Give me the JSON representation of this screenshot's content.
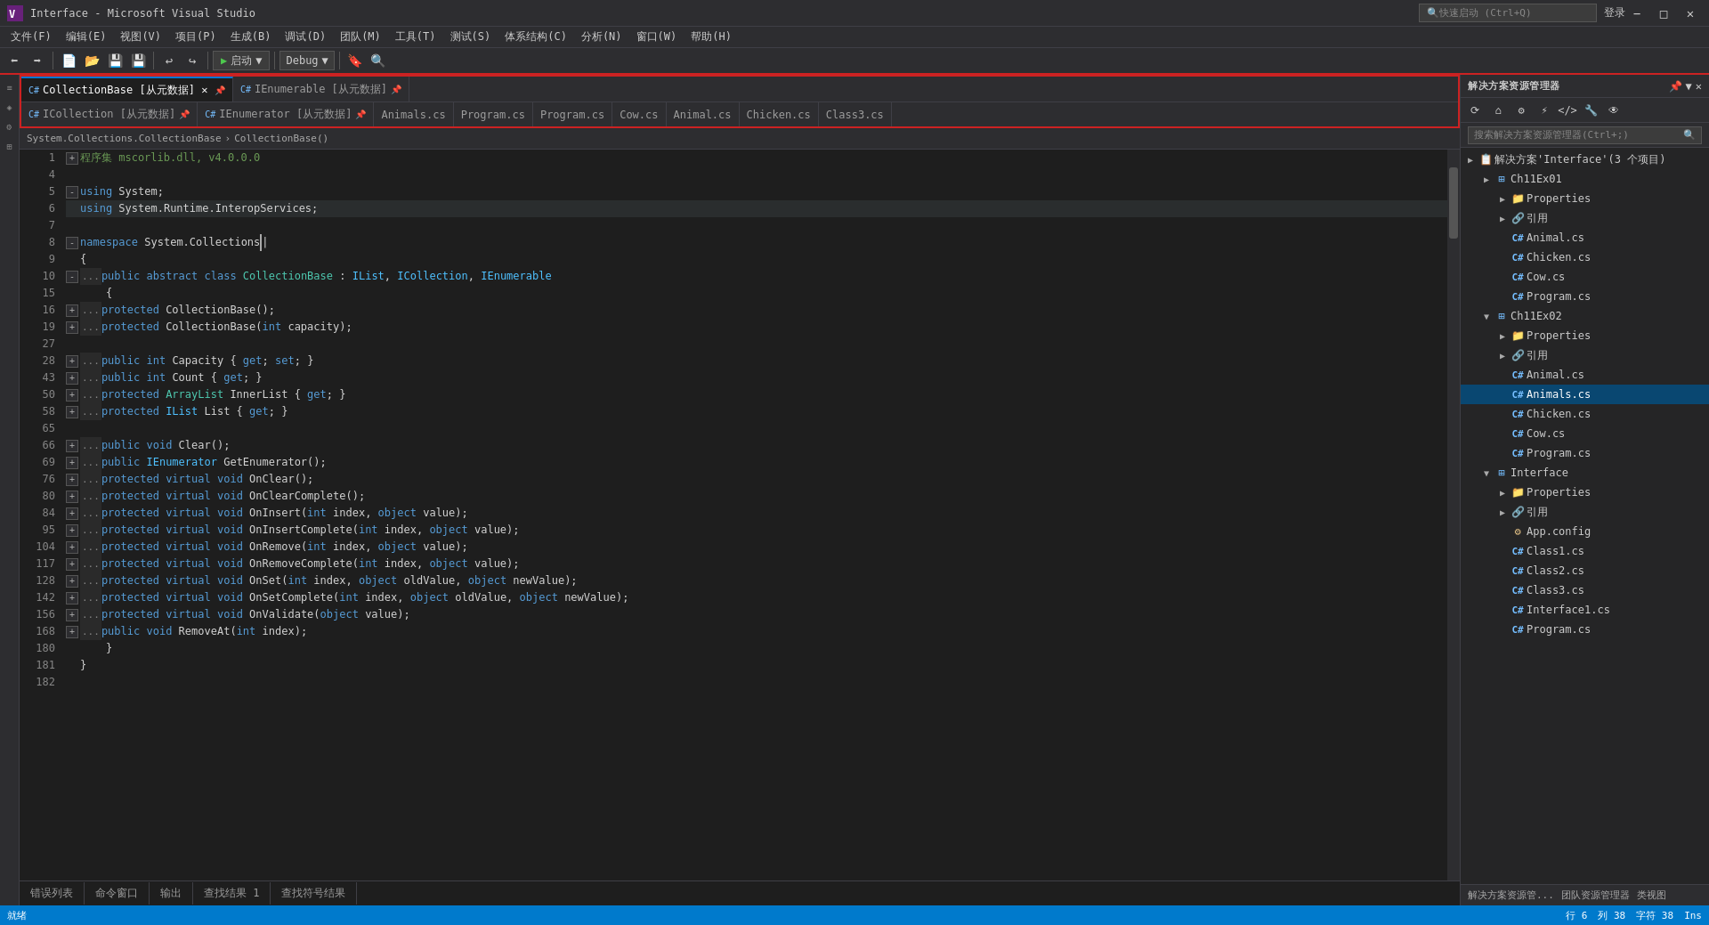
{
  "titleBar": {
    "title": "Interface - Microsoft Visual Studio",
    "quickLaunch": "快速启动 (Ctrl+Q)"
  },
  "menuBar": {
    "items": [
      "文件(F)",
      "编辑(E)",
      "视图(V)",
      "项目(P)",
      "生成(B)",
      "调试(D)",
      "团队(M)",
      "工具(T)",
      "测试(S)",
      "体系结构(C)",
      "分析(N)",
      "窗口(W)",
      "帮助(H)"
    ]
  },
  "toolbar": {
    "debugConfig": "Debug",
    "startBtn": "启动",
    "loginBtn": "登录"
  },
  "tabBarTop": {
    "tabs": [
      {
        "label": "CollectionBase [从元数据]",
        "active": true,
        "hasClose": true,
        "icon": "C#"
      },
      {
        "label": "IEnumerable [从元数据]",
        "active": false,
        "hasClose": false,
        "icon": "C#"
      }
    ]
  },
  "tabBarBottom": {
    "tabs": [
      {
        "label": "ICollection [从元数据]",
        "active": false,
        "icon": "C#"
      },
      {
        "label": "IEnumerator [从元数据]",
        "active": false,
        "icon": "C#"
      },
      {
        "label": "Animals.cs",
        "active": false,
        "icon": "C#"
      },
      {
        "label": "Program.cs",
        "active": false,
        "icon": "C#"
      },
      {
        "label": "Program.cs",
        "active": false,
        "icon": "C#"
      },
      {
        "label": "Cow.cs",
        "active": false,
        "icon": "C#"
      },
      {
        "label": "Animal.cs",
        "active": false,
        "icon": "C#"
      },
      {
        "label": "Chicken.cs",
        "active": false,
        "icon": "C#"
      },
      {
        "label": "Class3.cs",
        "active": false,
        "icon": "C#"
      }
    ]
  },
  "codeNav": {
    "namespace": "System.Collections.CollectionBase",
    "method": "CollectionBase()"
  },
  "codeLines": [
    {
      "num": "1",
      "content": "程序集 mscorlib.dll, v4.0.0.0",
      "type": "comment"
    },
    {
      "num": "4",
      "content": ""
    },
    {
      "num": "5",
      "content": "using System;"
    },
    {
      "num": "6",
      "content": "using System.Runtime.InteropServices;"
    },
    {
      "num": "7",
      "content": ""
    },
    {
      "num": "8",
      "content": "namespace System.Collections"
    },
    {
      "num": "9",
      "content": "{"
    },
    {
      "num": "10",
      "content": "    public abstract class CollectionBase : IList, ICollection, IEnumerable"
    },
    {
      "num": "15",
      "content": "    {"
    },
    {
      "num": "16",
      "content": "        protected CollectionBase();"
    },
    {
      "num": "19",
      "content": "        protected CollectionBase(int capacity);"
    },
    {
      "num": "27",
      "content": ""
    },
    {
      "num": "28",
      "content": "        public int Capacity { get; set; }"
    },
    {
      "num": "43",
      "content": "        public int Count { get; }"
    },
    {
      "num": "50",
      "content": "        protected ArrayList InnerList { get; }"
    },
    {
      "num": "58",
      "content": "        protected IList List { get; }"
    },
    {
      "num": "65",
      "content": ""
    },
    {
      "num": "66",
      "content": "        public void Clear();"
    },
    {
      "num": "69",
      "content": "        public IEnumerator GetEnumerator();"
    },
    {
      "num": "76",
      "content": "        protected virtual void OnClear();"
    },
    {
      "num": "80",
      "content": "        protected virtual void OnClearComplete();"
    },
    {
      "num": "84",
      "content": "        protected virtual void OnInsert(int index, object value);"
    },
    {
      "num": "95",
      "content": "        protected virtual void OnInsertComplete(int index, object value);"
    },
    {
      "num": "104",
      "content": "        protected virtual void OnRemove(int index, object value);"
    },
    {
      "num": "117",
      "content": "        protected virtual void OnRemoveComplete(int index, object value);"
    },
    {
      "num": "128",
      "content": "        protected virtual void OnSet(int index, object oldValue, object newValue);"
    },
    {
      "num": "142",
      "content": "        protected virtual void OnSetComplete(int index, object oldValue, object newValue);"
    },
    {
      "num": "156",
      "content": "        protected virtual void OnValidate(object value);"
    },
    {
      "num": "168",
      "content": "        public void RemoveAt(int index);"
    },
    {
      "num": "180",
      "content": "    }"
    },
    {
      "num": "181",
      "content": "}"
    },
    {
      "num": "182",
      "content": ""
    }
  ],
  "solutionExplorer": {
    "title": "解决方案资源管理器",
    "searchPlaceholder": "搜索解决方案资源管理器(Ctrl+;)",
    "solutionLabel": "解决方案'Interface'(3 个项目)",
    "projects": [
      {
        "name": "Ch11Ex01",
        "children": [
          {
            "name": "Properties",
            "type": "folder"
          },
          {
            "name": "引用",
            "type": "ref"
          },
          {
            "name": "Animal.cs",
            "type": "cs"
          },
          {
            "name": "Chicken.cs",
            "type": "cs"
          },
          {
            "name": "Cow.cs",
            "type": "cs"
          },
          {
            "name": "Program.cs",
            "type": "cs"
          }
        ]
      },
      {
        "name": "Ch11Ex02",
        "children": [
          {
            "name": "Properties",
            "type": "folder"
          },
          {
            "name": "引用",
            "type": "ref"
          },
          {
            "name": "Animal.cs",
            "type": "cs"
          },
          {
            "name": "Animals.cs",
            "type": "cs",
            "selected": true
          },
          {
            "name": "Chicken.cs",
            "type": "cs"
          },
          {
            "name": "Cow.cs",
            "type": "cs"
          },
          {
            "name": "Program.cs",
            "type": "cs"
          }
        ]
      },
      {
        "name": "Interface",
        "children": [
          {
            "name": "Properties",
            "type": "folder"
          },
          {
            "name": "引用",
            "type": "ref"
          },
          {
            "name": "App.config",
            "type": "config"
          },
          {
            "name": "Class1.cs",
            "type": "cs"
          },
          {
            "name": "Class2.cs",
            "type": "cs"
          },
          {
            "name": "Class3.cs",
            "type": "cs"
          },
          {
            "name": "Interface1.cs",
            "type": "cs"
          },
          {
            "name": "Program.cs",
            "type": "cs"
          }
        ]
      }
    ]
  },
  "bottomTabs": [
    "错误列表",
    "命令窗口",
    "输出",
    "查找结果 1",
    "查找符号结果"
  ],
  "panelFooterTabs": [
    "解决方案资源管...",
    "团队资源管理器",
    "类视图"
  ],
  "statusBar": {
    "left": "就绪",
    "row": "行 6",
    "col": "列 38",
    "char": "字符 38",
    "ins": "Ins"
  }
}
